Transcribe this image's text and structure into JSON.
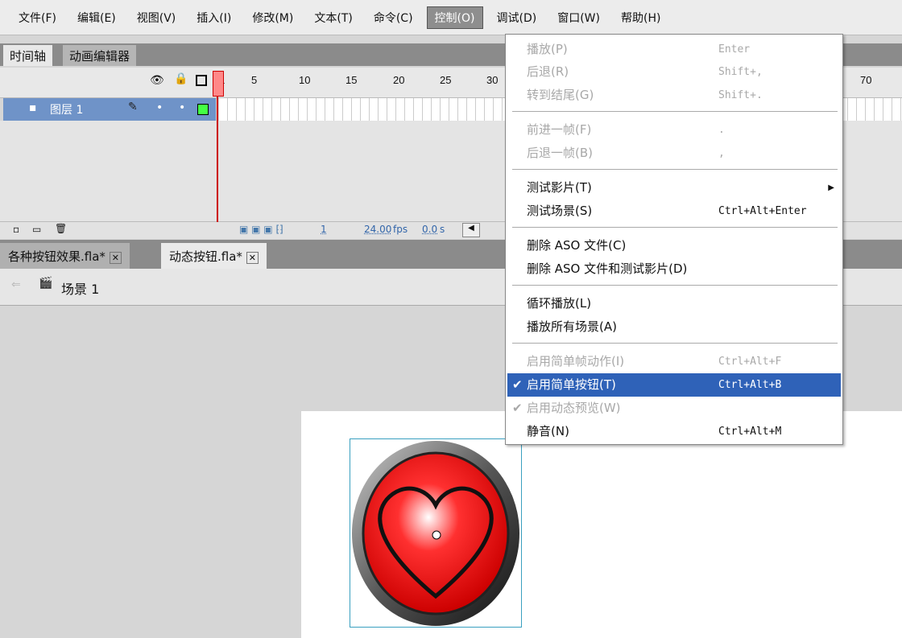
{
  "menubar": [
    "文件(F)",
    "编辑(E)",
    "视图(V)",
    "插入(I)",
    "修改(M)",
    "文本(T)",
    "命令(C)",
    "控制(O)",
    "调试(D)",
    "窗口(W)",
    "帮助(H)"
  ],
  "timeline": {
    "tabs": [
      "时间轴",
      "动画编辑器"
    ],
    "ruler": [
      "1",
      "5",
      "10",
      "15",
      "20",
      "25",
      "30",
      "70"
    ],
    "layer": "图层 1",
    "frame": "1",
    "fps": "24.00",
    "fps_unit": "fps",
    "time": "0.0",
    "time_unit": "s"
  },
  "doc_tabs": [
    "各种按钮效果.fla*",
    "动态按钮.fla*"
  ],
  "scene": "场景 1",
  "control_menu": [
    {
      "label": "播放(P)",
      "shortcut": "Enter",
      "disabled": true
    },
    {
      "label": "后退(R)",
      "shortcut": "Shift+,",
      "disabled": true
    },
    {
      "label": "转到结尾(G)",
      "shortcut": "Shift+.",
      "disabled": true
    },
    {
      "label": "前进一帧(F)",
      "shortcut": ".",
      "disabled": true
    },
    {
      "label": "后退一帧(B)",
      "shortcut": ",",
      "disabled": true
    },
    {
      "label": "测试影片(T)",
      "shortcut": "",
      "submenu": true
    },
    {
      "label": "测试场景(S)",
      "shortcut": "Ctrl+Alt+Enter"
    },
    {
      "label": "删除 ASO 文件(C)",
      "shortcut": ""
    },
    {
      "label": "删除 ASO 文件和测试影片(D)",
      "shortcut": ""
    },
    {
      "label": "循环播放(L)",
      "shortcut": ""
    },
    {
      "label": "播放所有场景(A)",
      "shortcut": ""
    },
    {
      "label": "启用简单帧动作(I)",
      "shortcut": "Ctrl+Alt+F",
      "disabled": true
    },
    {
      "label": "启用简单按钮(T)",
      "shortcut": "Ctrl+Alt+B",
      "checked": true,
      "highlighted": true
    },
    {
      "label": "启用动态预览(W)",
      "shortcut": "",
      "checked": true,
      "disabled": true
    },
    {
      "label": "静音(N)",
      "shortcut": "Ctrl+Alt+M"
    }
  ],
  "check_glyph": "✔",
  "submenu_glyph": "▶"
}
